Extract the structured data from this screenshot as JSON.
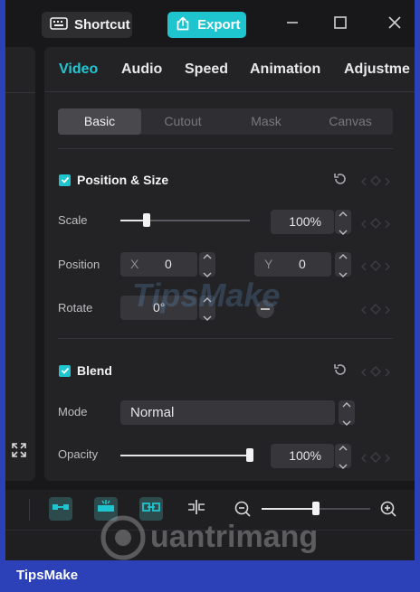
{
  "toolbar": {
    "shortcut_label": "Shortcut",
    "export_label": "Export"
  },
  "tabs": [
    {
      "label": "Video",
      "active": true
    },
    {
      "label": "Audio",
      "active": false
    },
    {
      "label": "Speed",
      "active": false
    },
    {
      "label": "Animation",
      "active": false
    },
    {
      "label": "Adjustme",
      "active": false
    }
  ],
  "subtabs": [
    {
      "label": "Basic",
      "active": true
    },
    {
      "label": "Cutout",
      "active": false
    },
    {
      "label": "Mask",
      "active": false
    },
    {
      "label": "Canvas",
      "active": false
    }
  ],
  "position_size": {
    "title": "Position & Size",
    "enabled": true,
    "scale": {
      "label": "Scale",
      "value": "100%",
      "level": 0.2
    },
    "position": {
      "label": "Position",
      "x_label": "X",
      "x_value": "0",
      "y_label": "Y",
      "y_value": "0"
    },
    "rotate": {
      "label": "Rotate",
      "value": "0°"
    }
  },
  "blend": {
    "title": "Blend",
    "enabled": true,
    "mode": {
      "label": "Mode",
      "value": "Normal"
    },
    "opacity": {
      "label": "Opacity",
      "value": "100%",
      "level": 1.0
    }
  },
  "timeline": {
    "zoom_level": 0.5
  },
  "watermarks": {
    "center": "TipsMake",
    "bottom": "uantrimang"
  },
  "footer": {
    "brand": "TipsMake"
  },
  "colors": {
    "accent": "#1ec5cf",
    "background": "#18181a",
    "panel": "#232326",
    "frame_border": "#2c40b8"
  }
}
